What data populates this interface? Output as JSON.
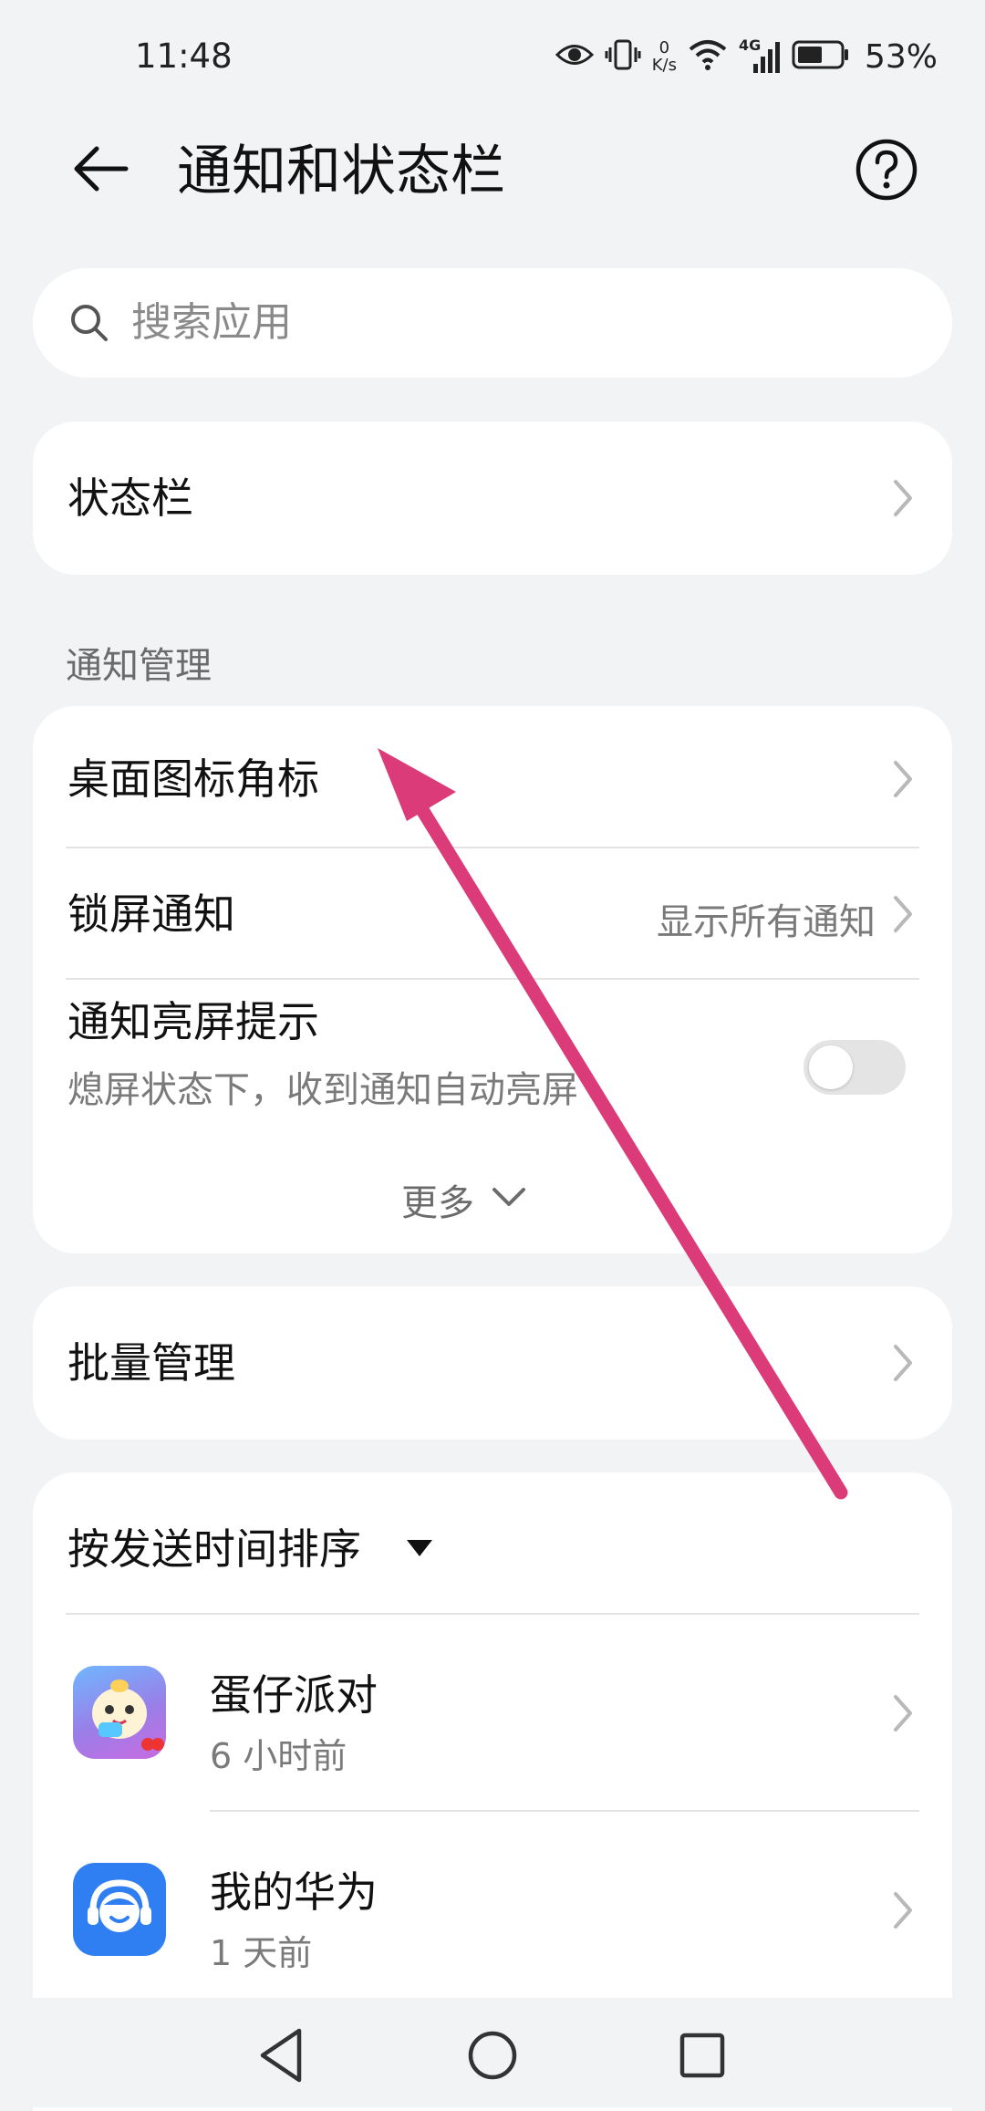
{
  "status_bar": {
    "time": "11:48",
    "net_speed_value": "0",
    "net_speed_unit": "K/s",
    "network_type": "4G",
    "battery_percent": "53%"
  },
  "header": {
    "title": "通知和状态栏"
  },
  "search": {
    "placeholder": "搜索应用"
  },
  "status_bar_row": {
    "label": "状态栏"
  },
  "notification_section": {
    "title": "通知管理",
    "badge_row": {
      "label": "桌面图标角标"
    },
    "lockscreen_row": {
      "label": "锁屏通知",
      "value": "显示所有通知"
    },
    "wake_row": {
      "label": "通知亮屏提示",
      "subtitle": "熄屏状态下，收到通知自动亮屏",
      "toggle_on": false
    },
    "more_label": "更多"
  },
  "batch_row": {
    "label": "批量管理"
  },
  "apps_section": {
    "sort_label": "按发送时间排序",
    "apps": [
      {
        "name": "蛋仔派对",
        "time": "6 小时前",
        "icon": "eggy-party-app-icon"
      },
      {
        "name": "我的华为",
        "time": "1 天前",
        "icon": "my-huawei-app-icon"
      }
    ]
  },
  "colors": {
    "background": "#f1f3f5",
    "card": "#ffffff",
    "annotation_arrow": "#dc3b7a",
    "my_huawei_blue": "#2f7ff2"
  }
}
